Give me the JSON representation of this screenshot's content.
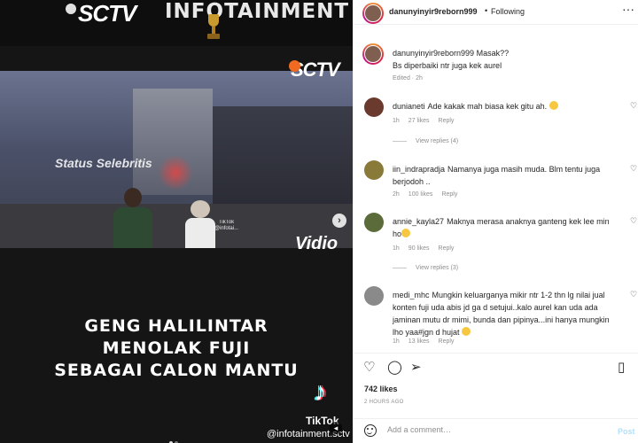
{
  "media": {
    "brand": "SCTV",
    "show": "INFOTAINMENT",
    "corner_brand": "SCTV",
    "watermark": "Status Selebritis",
    "tiktok_small": "TikTok",
    "tiktok_small_handle": "@infotai...",
    "vidio": "Vidio",
    "headline_lines": [
      "GENG HALILINTAR",
      "MENOLAK FUJI",
      "SEBAGAI CALON MANTU"
    ],
    "tiktok_name": "TikTok",
    "tiktok_handle": "@infotainment.sctv"
  },
  "post": {
    "username": "danunyinyir9reborn999",
    "separator": "•",
    "follow_status": "Following",
    "more_icon": "more-horizontal-icon",
    "caption": {
      "username": "danunyinyir9reborn999",
      "text_line1": "Masak??",
      "text_line2": "Bs diperbaiki ntr juga kek aurel",
      "meta": "Edited · 2h"
    },
    "comments": [
      {
        "username": "dunianeti",
        "text": "Ade kakak mah biasa kek gitu ah. ",
        "has_emoji": true,
        "time": "1h",
        "likes": "27 likes",
        "reply": "Reply",
        "view_replies": "View replies (4)",
        "avatar_color": "#6b3a2e"
      },
      {
        "username": "iin_indraprad ja",
        "username_display": "iin_indrapradja",
        "text": "Namanya juga masih muda. Blm tentu juga berjodoh ..",
        "has_emoji": false,
        "time": "2h",
        "likes": "100 likes",
        "reply": "Reply",
        "view_replies": "",
        "avatar_color": "#8a7a3a"
      },
      {
        "username": "annie_kayla27",
        "text": "Maknya merasa anaknya ganteng kek lee min ho",
        "has_emoji": true,
        "time": "1h",
        "likes": "90 likes",
        "reply": "Reply",
        "view_replies": "View replies (3)",
        "avatar_color": "#5c6b3a"
      },
      {
        "username": "medi_mhc",
        "text": "Mungkin keluarganya mikir ntr 1-2 thn lg nilai jual konten fuji uda abis jd ga d setujui..kalo aurel kan uda ada jaminan mutu dr mimi, bunda dan pipinya...ini hanya mungkin lho yaa#jgn d hujat ",
        "has_emoji": true,
        "time": "1h",
        "likes": "13 likes",
        "reply": "Reply",
        "view_replies": "",
        "avatar_color": "#8a8a8a"
      }
    ],
    "actions": {
      "like_icon": "heart-icon",
      "comment_icon": "comment-icon",
      "share_icon": "share-icon",
      "save_icon": "bookmark-icon"
    },
    "likes": "742 likes",
    "time_ago": "2 HOURS AGO",
    "add_comment_placeholder": "Add a comment…",
    "post_label": "Post"
  }
}
